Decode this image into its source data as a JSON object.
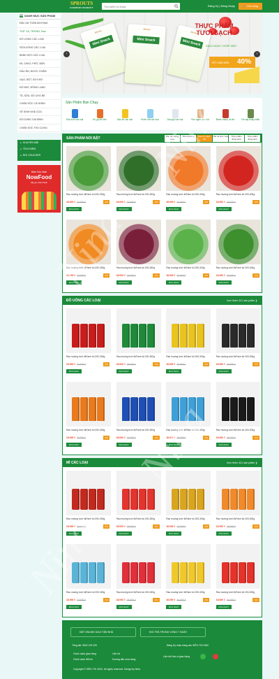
{
  "header": {
    "logo_main": "SPROUTS",
    "logo_sub": "FARMERS MARKET",
    "search_placeholder": "Tìm kiếm từ khoá",
    "auth": "Đăng Ký | Đăng Nhập",
    "cart": "Giỏ hàng"
  },
  "sidebar": {
    "title": "DANH MỤC SẢN PHẨM",
    "items": [
      "ĐẶC AN TOÀN ANYHAM",
      "THỊT CÁ, TRỨNG, Rau",
      "ĐỒ UỐNG CÁC LOẠI",
      "SỮA UỐNG CÁC LOẠI",
      "BÁNH KẸO CÁC LOẠI",
      "MÌ, CHÁO, PHỞ, BÚN",
      "DẦU ĂN, NƯỚC CHẤM",
      "GẠO, BỘT, ĐỒ KHÔ",
      "ĐỒ MÁT, ĐÔNG LẠNH",
      "TÃ, SỮA, ĐỒ CHO BÉ",
      "CHĂM SÓC CÁ NHÂN",
      "VỆ SINH NHÀ CỬA",
      "ĐỒ DÙNG GIA ĐÌNH",
      "CHĂM SÓC THÚ CƯNG"
    ],
    "active_index": 1,
    "promo": [
      "KHUYẾN MÃI",
      "TÍCH ĐIỂM",
      "ĐỔI VOUCHER"
    ]
  },
  "nowfood": {
    "brand": "Bách Hóa Xanh",
    "title": "NowFood",
    "sub": "Hãy gọi, thật nhanh"
  },
  "banner": {
    "pack_brand": "Miniso",
    "pack_label": "Mini Snack",
    "title_line1": "THỰC PHẨM",
    "title_line2": "TƯƠI SẠCH",
    "subtitle": "GIAO NGAY CHỚP MẮT",
    "discount_label": "TIẾT KIỆM ĐẾN",
    "discount": "40%",
    "prev": "‹",
    "next": "›"
  },
  "bestsellers": {
    "title": "Sản Phẩm Bán Chạy",
    "items": [
      {
        "label": "Sữa tươi các loại",
        "color": "#2f7fd6"
      },
      {
        "label": "Mì, gói ăn liền",
        "color": "#e6702a"
      },
      {
        "label": "Dầu ăn các loại",
        "color": "#f3c321"
      },
      {
        "label": "Khăn ướt các loại",
        "color": "#8fd0f2"
      },
      {
        "label": "Dầu gội các loại",
        "color": "#e0e6ee"
      },
      {
        "label": "Bao ngon các loại",
        "color": "#e3b38a"
      },
      {
        "label": "Bánh snack, đồ ăn",
        "color": "#c63a2c"
      },
      {
        "label": "Trà cấp nhập khẩu",
        "color": "#6a8a4a"
      }
    ]
  },
  "product": {
    "name": "Rau muống tươi 4kFarm túi 200-300g",
    "price": "18.000 ₫",
    "old_price": "24.000 ₫",
    "discount": "-5%",
    "buy": "MUA NGAY"
  },
  "sections": [
    {
      "title": "SẢN PHẨM NỔI BẬT",
      "more": "",
      "tabs": [
        "Thịt, cá, trứng, hoa",
        "Thịt cá trứng",
        "Rau củ, nấm, trái",
        "Thịt cá tươi, hoa",
        "Thực phẩm đông lạnh",
        "Thực phẩm đông lạnh"
      ],
      "active_tab": 2,
      "colors": [
        "#4a9b3a",
        "#2f6f2a",
        "#f07a2a",
        "#d3251f",
        "#f08a22",
        "#7a1f3a",
        "#5bb24a",
        "#3e8f2e"
      ]
    },
    {
      "title": "ĐỒ UỐNG CÁC LOẠI",
      "more": "Xem thêm 321 sản phẩm ❯",
      "tabs": [],
      "active_tab": -1,
      "colors": [
        "#c81d1d",
        "#1f8a3a",
        "#e9c31e",
        "#2a2a2a",
        "#e97a1d",
        "#1f4fb4",
        "#3fa0d8",
        "#1a1a1a"
      ]
    },
    {
      "title": "MÌ CÁC LOẠI",
      "more": "Xem thêm 321 sản phẩm ❯",
      "tabs": [],
      "active_tab": -1,
      "colors": [
        "#c22a1f",
        "#e2352e",
        "#d9a51f",
        "#f08a2a",
        "#5ab4d8",
        "#e0303a",
        "#f0c82a",
        "#e3332a"
      ]
    }
  ],
  "footer": {
    "btn1": "ĐẶT ONLINE GIAO TẬN NHÀ",
    "btn2": "ĐỔI TRẢ TRONG VÒNG 7 NGÀY",
    "hotline": "Tổng đài: 0832 129 225",
    "reg": "Đăng Ký chào hàng vào SIÊU THỊ VINC",
    "link1": "Chính sách giao hàng",
    "link2": "Liên hệ",
    "link3": "Chính sách đổi trả",
    "link4": "Hướng dẫn mua hàng",
    "connect": "Liên kết đơn vị giao hàng",
    "copyright": "Copyright © SIÊU THỊ VINC. All rights reserved. Design by Nina"
  },
  "watermark": "Nina",
  "colors": {
    "primary": "#1b8a3a",
    "accent": "#f29b1d",
    "price": "#e8421e"
  }
}
